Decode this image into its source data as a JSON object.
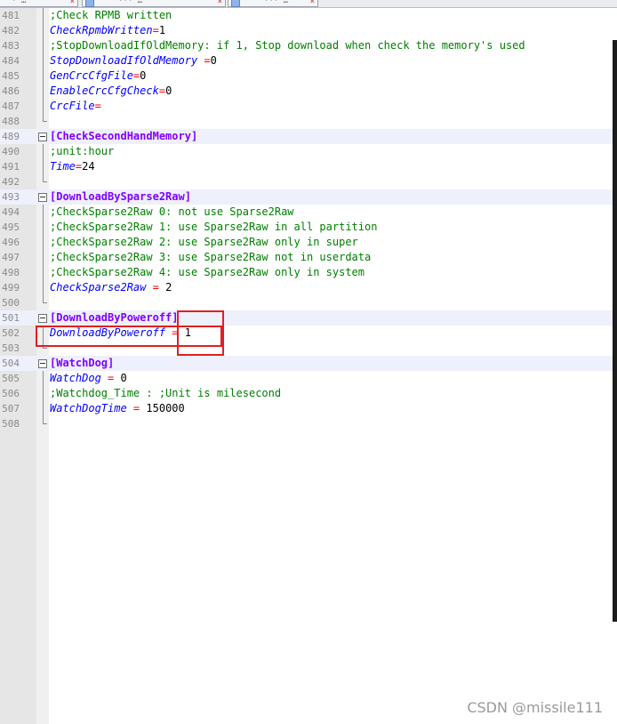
{
  "tabs": [
    {
      "label": "· …",
      "close": "×"
    },
    {
      "label": "··· …",
      "close": "×"
    },
    {
      "label": "··· …",
      "close": "×"
    }
  ],
  "editor": {
    "lines": [
      {
        "n": "481",
        "kind": "comment",
        "text": ";Check RPMB written"
      },
      {
        "n": "482",
        "kind": "kv",
        "key": "CheckRpmbWritten",
        "op": "=",
        "val": "1"
      },
      {
        "n": "483",
        "kind": "comment",
        "text": ";StopDownloadIfOldMemory: if 1, Stop download when check the memory's used"
      },
      {
        "n": "484",
        "kind": "kv",
        "key": "StopDownloadIfOldMemory",
        "op": " =",
        "val": "0"
      },
      {
        "n": "485",
        "kind": "kv",
        "key": "GenCrcCfgFile",
        "op": "=",
        "val": "0"
      },
      {
        "n": "486",
        "kind": "kv",
        "key": "EnableCrcCfgCheck",
        "op": "=",
        "val": "0"
      },
      {
        "n": "487",
        "kind": "kv",
        "key": "CrcFile",
        "op": "=",
        "val": ""
      },
      {
        "n": "488",
        "kind": "end"
      },
      {
        "n": "489",
        "kind": "section",
        "text": "[CheckSecondHandMemory]"
      },
      {
        "n": "490",
        "kind": "comment",
        "text": ";unit:hour"
      },
      {
        "n": "491",
        "kind": "kv",
        "key": "Time",
        "op": "=",
        "val": "24"
      },
      {
        "n": "492",
        "kind": "end"
      },
      {
        "n": "493",
        "kind": "section",
        "text": "[DownloadBySparse2Raw]"
      },
      {
        "n": "494",
        "kind": "comment",
        "text": ";CheckSparse2Raw 0: not use Sparse2Raw"
      },
      {
        "n": "495",
        "kind": "comment",
        "text": ";CheckSparse2Raw 1: use Sparse2Raw in all partition"
      },
      {
        "n": "496",
        "kind": "comment",
        "text": ";CheckSparse2Raw 2: use Sparse2Raw only in super"
      },
      {
        "n": "497",
        "kind": "comment",
        "text": ";CheckSparse2Raw 3: use Sparse2Raw not in userdata"
      },
      {
        "n": "498",
        "kind": "comment",
        "text": ";CheckSparse2Raw 4: use Sparse2Raw only in system"
      },
      {
        "n": "499",
        "kind": "kv",
        "key": "CheckSparse2Raw",
        "op": " = ",
        "val": "2"
      },
      {
        "n": "500",
        "kind": "end"
      },
      {
        "n": "501",
        "kind": "section",
        "text": "[DownloadByPoweroff]"
      },
      {
        "n": "502",
        "kind": "kv",
        "key": "DownloadByPoweroff",
        "op": " = ",
        "val": "1"
      },
      {
        "n": "503",
        "kind": "end"
      },
      {
        "n": "504",
        "kind": "section",
        "text": "[WatchDog]"
      },
      {
        "n": "505",
        "kind": "kv",
        "key": "WatchDog",
        "op": " = ",
        "val": "0"
      },
      {
        "n": "506",
        "kind": "comment",
        "text": ";Watchdog_Time : ;Unit is milesecond"
      },
      {
        "n": "507",
        "kind": "kv",
        "key": "WatchDogTime",
        "op": " = ",
        "val": "150000"
      },
      {
        "n": "508",
        "kind": "end"
      }
    ]
  },
  "watermark": "CSDN @missile111",
  "colors": {
    "annotation": "#e02020",
    "comment": "#008000",
    "key": "#0000ff",
    "section": "#8000ff",
    "operator": "#ff0000"
  }
}
